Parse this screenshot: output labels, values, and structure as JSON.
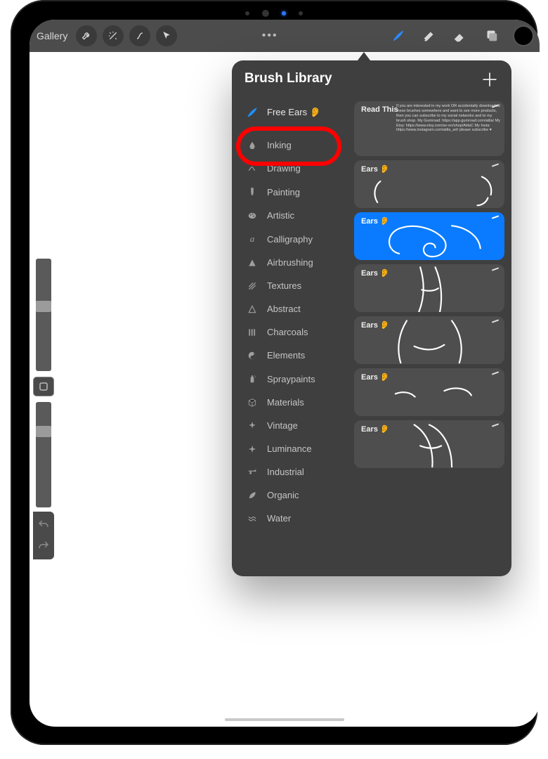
{
  "toolbar": {
    "gallery_label": "Gallery"
  },
  "brush_library": {
    "title": "Brush Library",
    "categories": {
      "recent": "Free Ears 👂",
      "items": [
        "Inking",
        "Drawing",
        "Painting",
        "Artistic",
        "Calligraphy",
        "Airbrushing",
        "Textures",
        "Abstract",
        "Charcoals",
        "Elements",
        "Spraypaints",
        "Materials",
        "Vintage",
        "Luminance",
        "Industrial",
        "Organic",
        "Water"
      ]
    },
    "readthis": {
      "title": "Read This",
      "body": "If you are interested in my work OR accidentally downloaded these brushes somewhere and want to see more products, then you can subscribe to my social networks and to my brush shop. My Gumroad: https://app.gumroad.com/atila/  My Etsy: https://www.etsy.com/se-en/shop/AtilaC  My Insta: https://www.instagram.com/atila_art/  please subscribe ♥"
    },
    "brushes": [
      {
        "name": "Ears 👂",
        "selected": false
      },
      {
        "name": "Ears 👂",
        "selected": true
      },
      {
        "name": "Ears 👂",
        "selected": false
      },
      {
        "name": "Ears 👂",
        "selected": false
      },
      {
        "name": "Ears 👂",
        "selected": false
      },
      {
        "name": "Ears 👂",
        "selected": false
      }
    ]
  }
}
